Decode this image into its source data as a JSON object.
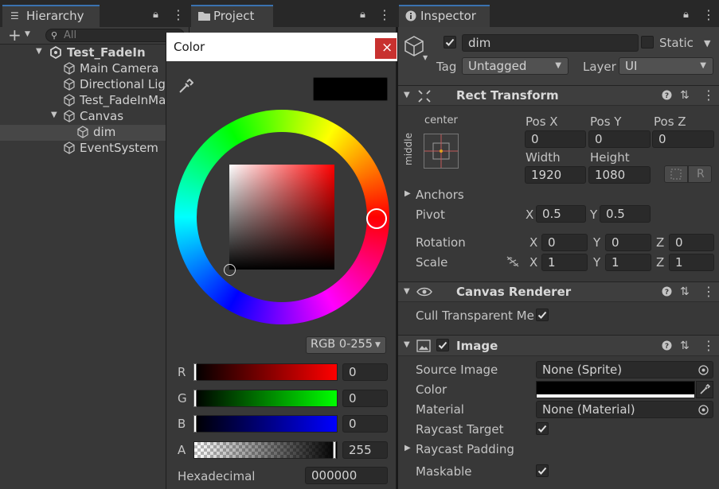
{
  "hierarchy": {
    "tab_label": "Hierarchy",
    "search_placeholder": "All",
    "scene_name": "Test_FadeIn",
    "items": [
      {
        "label": "Main Camera"
      },
      {
        "label": "Directional Light"
      },
      {
        "label": "Test_FadeInManager"
      },
      {
        "label": "Canvas"
      },
      {
        "label": "dim"
      },
      {
        "label": "EventSystem"
      }
    ]
  },
  "project": {
    "tab_label": "Project"
  },
  "inspector": {
    "tab_label": "Inspector",
    "object_name": "dim",
    "static_label": "Static",
    "tag_label": "Tag",
    "tag_value": "Untagged",
    "layer_label": "Layer",
    "layer_value": "UI",
    "rect_transform": {
      "title": "Rect Transform",
      "anchor_h": "center",
      "anchor_v": "middle",
      "pos_x_label": "Pos X",
      "pos_x": "0",
      "pos_y_label": "Pos Y",
      "pos_y": "0",
      "pos_z_label": "Pos Z",
      "pos_z": "0",
      "width_label": "Width",
      "width": "1920",
      "height_label": "Height",
      "height": "1080",
      "raw_edit": "R",
      "anchors_label": "Anchors",
      "pivot_label": "Pivot",
      "pivot_x": "0.5",
      "pivot_y": "0.5",
      "rotation_label": "Rotation",
      "rot_x": "0",
      "rot_y": "0",
      "rot_z": "0",
      "scale_label": "Scale",
      "scale_x": "1",
      "scale_y": "1",
      "scale_z": "1",
      "x": "X",
      "y": "Y",
      "z": "Z"
    },
    "canvas_renderer": {
      "title": "Canvas Renderer",
      "cull_label": "Cull Transparent Mesh"
    },
    "image": {
      "title": "Image",
      "source_label": "Source Image",
      "source_value": "None (Sprite)",
      "color_label": "Color",
      "color_value": "#000000",
      "material_label": "Material",
      "material_value": "None (Material)",
      "raycast_target_label": "Raycast Target",
      "raycast_padding_label": "Raycast Padding",
      "maskable_label": "Maskable"
    }
  },
  "color_picker": {
    "title": "Color",
    "close": "×",
    "mode": "RGB 0-255",
    "r_label": "R",
    "r_value": "0",
    "g_label": "G",
    "g_value": "0",
    "b_label": "B",
    "b_value": "0",
    "a_label": "A",
    "a_value": "255",
    "hex_label": "Hexadecimal",
    "hex_value": "000000",
    "current_color": "#000000",
    "close_color": "#c8312f"
  }
}
